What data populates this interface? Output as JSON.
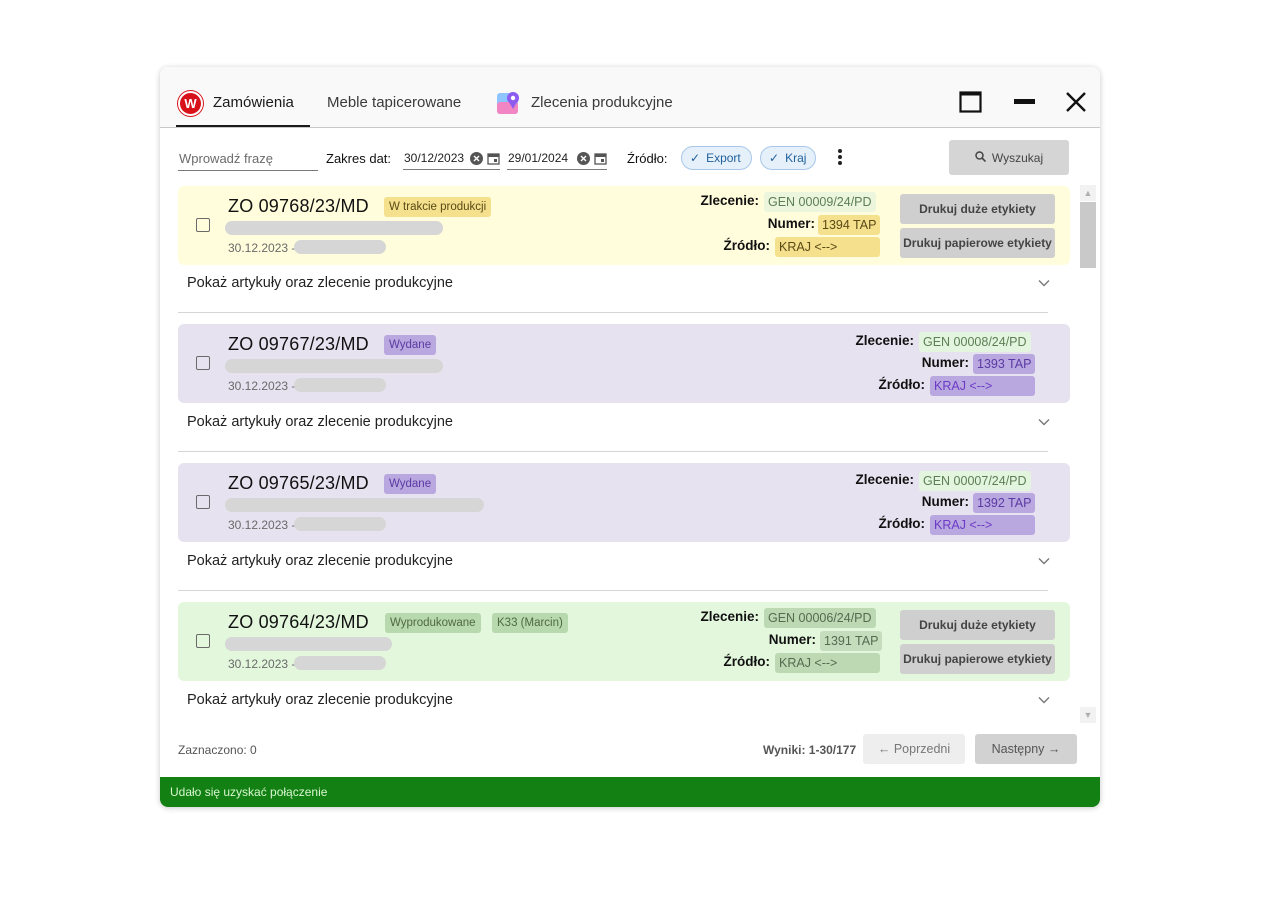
{
  "tabs": [
    {
      "label": "Zamówienia"
    },
    {
      "label": "Meble tapicerowane"
    },
    {
      "label": "Zlecenia produkcyjne"
    }
  ],
  "filter": {
    "phrase_placeholder": "Wprowadź frazę",
    "date_label": "Zakres dat:",
    "date_from": "30/12/2023",
    "date_to": "29/01/2024",
    "source_label": "Źródło:",
    "chips": [
      "Export",
      "Kraj"
    ],
    "search_label": "Wyszukaj"
  },
  "labels": {
    "order": "Zlecenie:",
    "number": "Numer:",
    "source": "Źródło:",
    "print_large": "Drukuj duże etykiety",
    "print_paper": "Drukuj papierowe etykiety",
    "expand": "Pokaż artykuły oraz zlecenie produkcyjne"
  },
  "orders": [
    {
      "id": "ZO 09768/23/MD",
      "status": "W trakcie produkcji",
      "date": "30.12.2023 -",
      "order": "GEN 00009/24/PD",
      "number": "1394 TAP",
      "source": "KRAJ <-->"
    },
    {
      "id": "ZO 09767/23/MD",
      "status": "Wydane",
      "date": "30.12.2023 -",
      "order": "GEN 00008/24/PD",
      "number": "1393 TAP",
      "source": "KRAJ <-->"
    },
    {
      "id": "ZO 09765/23/MD",
      "status": "Wydane",
      "date": "30.12.2023 -",
      "order": "GEN 00007/24/PD",
      "number": "1392 TAP",
      "source": "KRAJ <-->"
    },
    {
      "id": "ZO 09764/23/MD",
      "status": "Wyprodukowane",
      "status2": "K33 (Marcin)",
      "date": "30.12.2023 -",
      "order": "GEN 00006/24/PD",
      "number": "1391 TAP",
      "source": "KRAJ <-->"
    }
  ],
  "footer": {
    "selected": "Zaznaczono: 0",
    "results": "Wyniki: 1-30/177",
    "prev": "← Poprzedni",
    "next": "Następny →"
  },
  "status_bar": "Udało się uzyskać połączenie",
  "colors": {
    "brand_red": "#d8121b",
    "status_green": "#128012",
    "card_yellow": "#fffddb",
    "card_purple": "#e7e2f0",
    "card_green": "#e3f7dd"
  }
}
